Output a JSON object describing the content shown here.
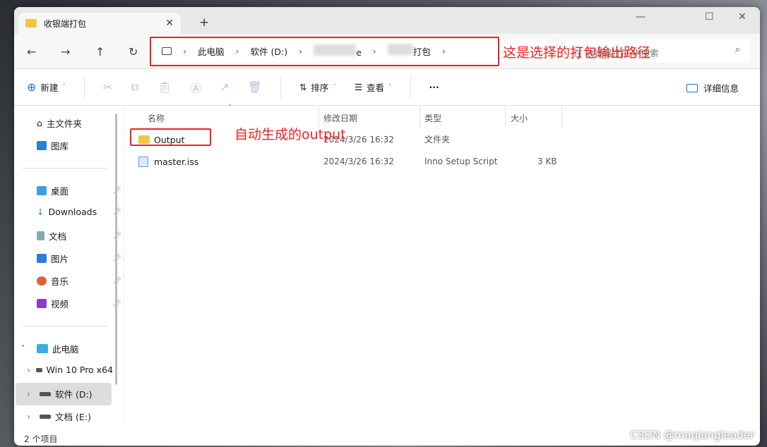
{
  "tab": {
    "title": "收银端打包",
    "close": "✕",
    "new_tab": "+"
  },
  "window_controls": {
    "minimize": "—",
    "maximize": "☐",
    "close": "✕"
  },
  "nav": {
    "back": "←",
    "forward": "→",
    "up": "↑",
    "refresh": "↻"
  },
  "breadcrumb": [
    "此电脑",
    "软件 (D:)",
    "e",
    "打包"
  ],
  "annotations": {
    "path": "这是选择的打包输出路径",
    "output": "自动生成的output"
  },
  "search": {
    "placeholder": "在 收银端打包 中搜索"
  },
  "toolbar": {
    "new": "新建",
    "sort": "排序",
    "view": "查看",
    "more": "···",
    "details": "详细信息"
  },
  "sidebar": {
    "top": [
      {
        "label": "主文件夹"
      },
      {
        "label": "图库"
      }
    ],
    "pinned": [
      {
        "label": "桌面"
      },
      {
        "label": "Downloads"
      },
      {
        "label": "文档"
      },
      {
        "label": "图片"
      },
      {
        "label": "音乐"
      },
      {
        "label": "视频"
      }
    ],
    "this_pc": "此电脑",
    "drives": [
      {
        "label": "Win 10 Pro x64"
      },
      {
        "label": "软件 (D:)"
      },
      {
        "label": "文档 (E:)"
      }
    ]
  },
  "columns": {
    "name": "名称",
    "modified": "修改日期",
    "type": "类型",
    "size": "大小"
  },
  "files": [
    {
      "name": "Output",
      "modified": "2024/3/26 16:32",
      "type": "文件夹",
      "size": ""
    },
    {
      "name": "master.iss",
      "modified": "2024/3/26 16:32",
      "type": "Inno Setup Script",
      "size": "3 KB"
    }
  ],
  "status": "2 个项目",
  "watermark": "CSDN @maqiangleader"
}
